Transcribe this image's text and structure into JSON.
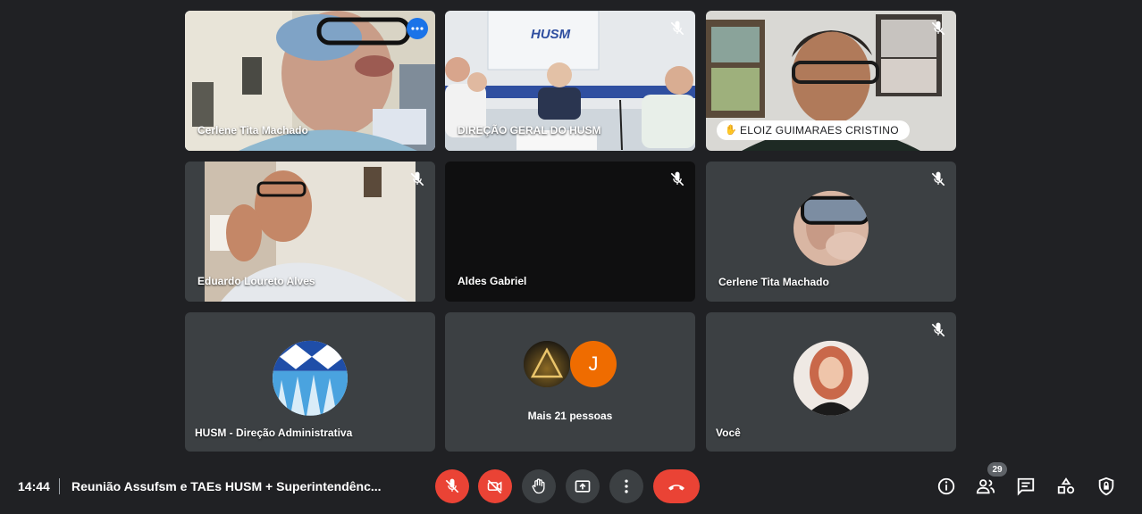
{
  "tiles": [
    {
      "name": "Cerlene Tita Machado"
    },
    {
      "name": "DIREÇÃO GERAL DO HUSM",
      "sign": "HUSM"
    },
    {
      "name": "ELOIZ GUIMARAES CRISTINO"
    },
    {
      "name": "Eduardo Loureto Alves"
    },
    {
      "name": "Aldes Gabriel"
    },
    {
      "name": "Cerlene Tita Machado"
    },
    {
      "name": "HUSM - Direção Administrativa"
    },
    {
      "name": "Mais 21 pessoas",
      "avatar_letter": "J"
    },
    {
      "name": "Você"
    }
  ],
  "bottombar": {
    "time": "14:44",
    "meeting_title": "Reunião Assufsm e TAEs HUSM + Superintendênc...",
    "participants_count": "29"
  },
  "colors": {
    "background": "#202124",
    "tile": "#3c4043",
    "danger": "#ea4335",
    "accent": "#8ab4f8"
  },
  "icons": [
    "mic-off-icon",
    "camera-off-icon",
    "raise-hand-icon",
    "present-icon",
    "more-vert-icon",
    "hangup-icon",
    "info-icon",
    "people-icon",
    "chat-icon",
    "activities-icon",
    "host-controls-icon"
  ]
}
